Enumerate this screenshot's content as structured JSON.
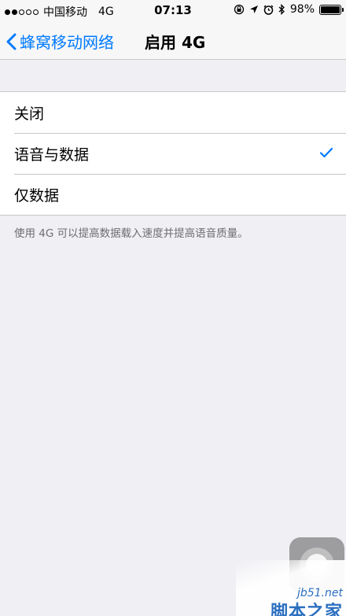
{
  "status_bar": {
    "carrier": "中国移动",
    "network": "4G",
    "time": "07:13",
    "battery": "98%",
    "battery_level": 0.98
  },
  "nav": {
    "back_label": "蜂窝移动网络",
    "title": "启用 4G"
  },
  "options": [
    {
      "label": "关闭",
      "selected": false
    },
    {
      "label": "语音与数据",
      "selected": true
    },
    {
      "label": "仅数据",
      "selected": false
    }
  ],
  "footer_note": "使用 4G 可以提高数据载入速度并提高语音质量。",
  "watermark": {
    "url": "jb51.net",
    "name": "脚本之家"
  },
  "colors": {
    "accent": "#007aff",
    "background": "#efeff4",
    "separator": "#c8c7cc",
    "footer_text": "#6d6d72"
  },
  "icons": [
    "back-chevron-icon",
    "checkmark-icon",
    "rotation-lock-icon",
    "location-icon",
    "alarm-icon",
    "bluetooth-icon",
    "battery-icon",
    "assistive-touch-icon"
  ]
}
